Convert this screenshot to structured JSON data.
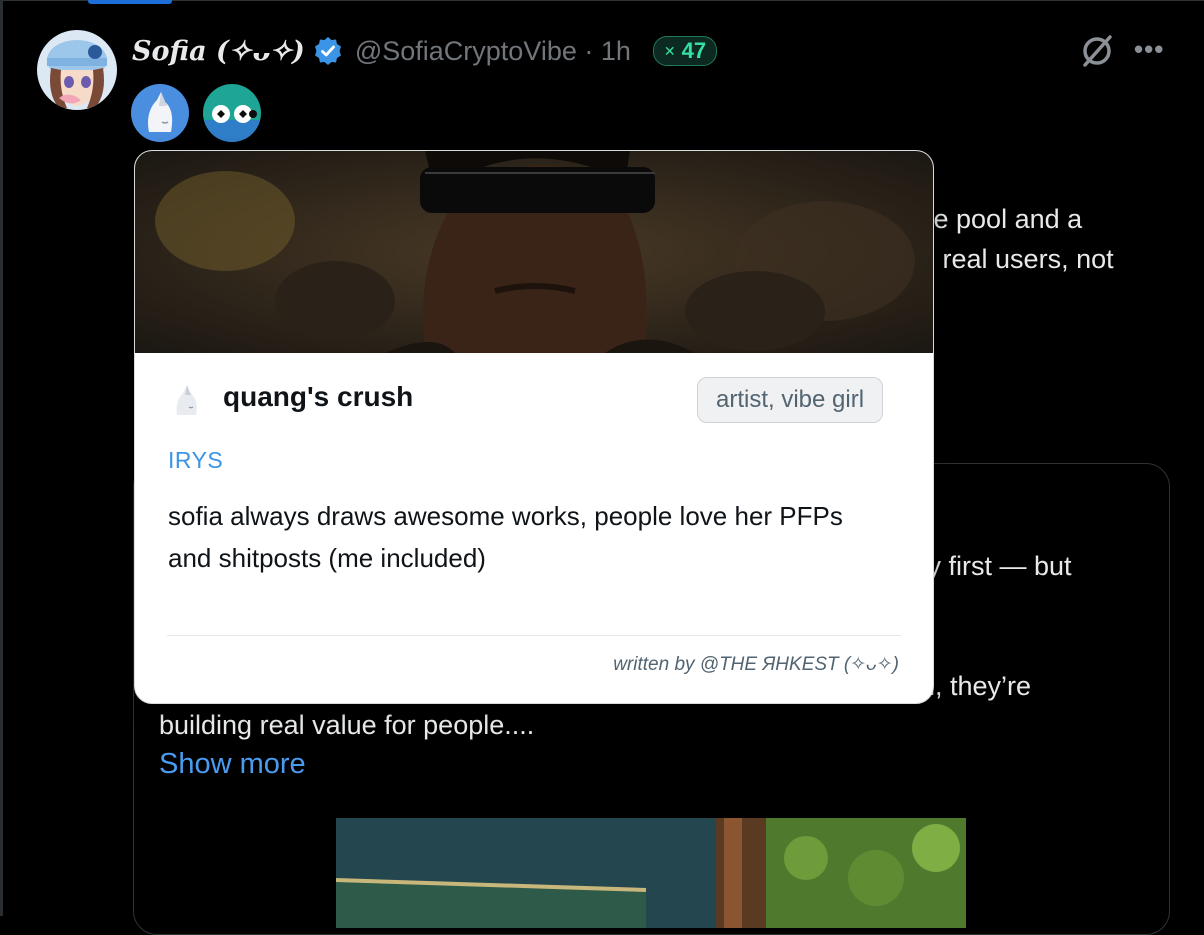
{
  "author": {
    "display_name": "Sofia (✧ᴗ✧)",
    "handle": "@SofiaCryptoVibe · 1h",
    "score": "47"
  },
  "icons": {
    "score": "x-logo-icon",
    "verified": "verified-badge-icon",
    "blocked": "blocked-slash-icon",
    "more": "more-dots-icon"
  },
  "tweet": {
    "line1": "ve pool and a",
    "line2": "d real users, not",
    "line3": "ty first — but",
    "line4": "h, they’re",
    "line5": "building real value for people....",
    "show_more": "Show more"
  },
  "popup": {
    "title": "quang's crush",
    "pill": "artist, vibe girl",
    "label": "IRYS",
    "description": "sofia always draws awesome works, people love her PFPs and shitposts (me included)",
    "footer": "written by @THE ЯHKEST (✧ᴗ✧)"
  },
  "colors": {
    "accent_blue": "#4a9bf0",
    "score_green": "#36e0a3",
    "background": "#000000",
    "popup_bg": "#ffffff"
  }
}
